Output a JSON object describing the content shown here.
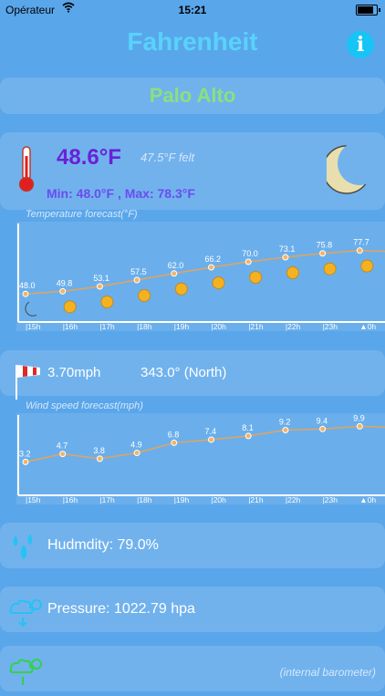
{
  "status_bar": {
    "carrier": "Opérateur",
    "time": "15:21"
  },
  "header": {
    "title": "Fahrenheit",
    "info_label": "i"
  },
  "city": "Palo Alto",
  "current": {
    "temperature": "48.6°F",
    "felt": "47.5°F felt",
    "min_max": "Min: 48.0°F , Max: 78.3°F",
    "condition_icon": "moon-icon"
  },
  "wind": {
    "speed": "3.70mph",
    "direction": "343.0° (North)"
  },
  "humidity": "Hudmdity: 79.0%",
  "pressure": "Pressure: 1022.79 hpa",
  "barometer_note": "(internal barometer)",
  "colors": {
    "background": "#5aa6ea",
    "title": "#58d3fb",
    "city": "#8be07c",
    "temp": "#6a20d8",
    "minmax": "#6b4cf0",
    "line": "#e6a35a"
  },
  "chart_data": [
    {
      "type": "line",
      "title": "Temperature forecast(°F)",
      "categories": [
        "15h",
        "16h",
        "17h",
        "18h",
        "19h",
        "20h",
        "21h",
        "22h",
        "23h",
        "0h"
      ],
      "values": [
        48.0,
        49.8,
        53.1,
        57.5,
        62.0,
        66.2,
        70.0,
        73.1,
        75.8,
        77.7
      ],
      "value_labels": [
        "48.0",
        "49.8",
        "53.1",
        "57.5",
        "62.0",
        "66.2",
        "70.0",
        "73.1",
        "75.8",
        "77.7"
      ],
      "icons": [
        "moon-icon",
        "sun-icon",
        "sun-icon",
        "sun-icon",
        "sun-icon",
        "sun-icon",
        "sun-icon",
        "sun-icon",
        "sun-icon",
        "sun-icon"
      ],
      "ylim": [
        40,
        80
      ]
    },
    {
      "type": "line",
      "title": "Wind speed forecast(mph)",
      "categories": [
        "15h",
        "16h",
        "17h",
        "18h",
        "19h",
        "20h",
        "21h",
        "22h",
        "23h",
        "0h"
      ],
      "values": [
        3.2,
        4.7,
        3.8,
        4.9,
        6.8,
        7.4,
        8.1,
        9.2,
        9.4,
        9.9
      ],
      "value_labels": [
        "3.2",
        "4.7",
        "3.8",
        "4.9",
        "6.8",
        "7.4",
        "8.1",
        "9.2",
        "9.4",
        "9.9"
      ],
      "ylim": [
        0,
        11
      ]
    }
  ]
}
